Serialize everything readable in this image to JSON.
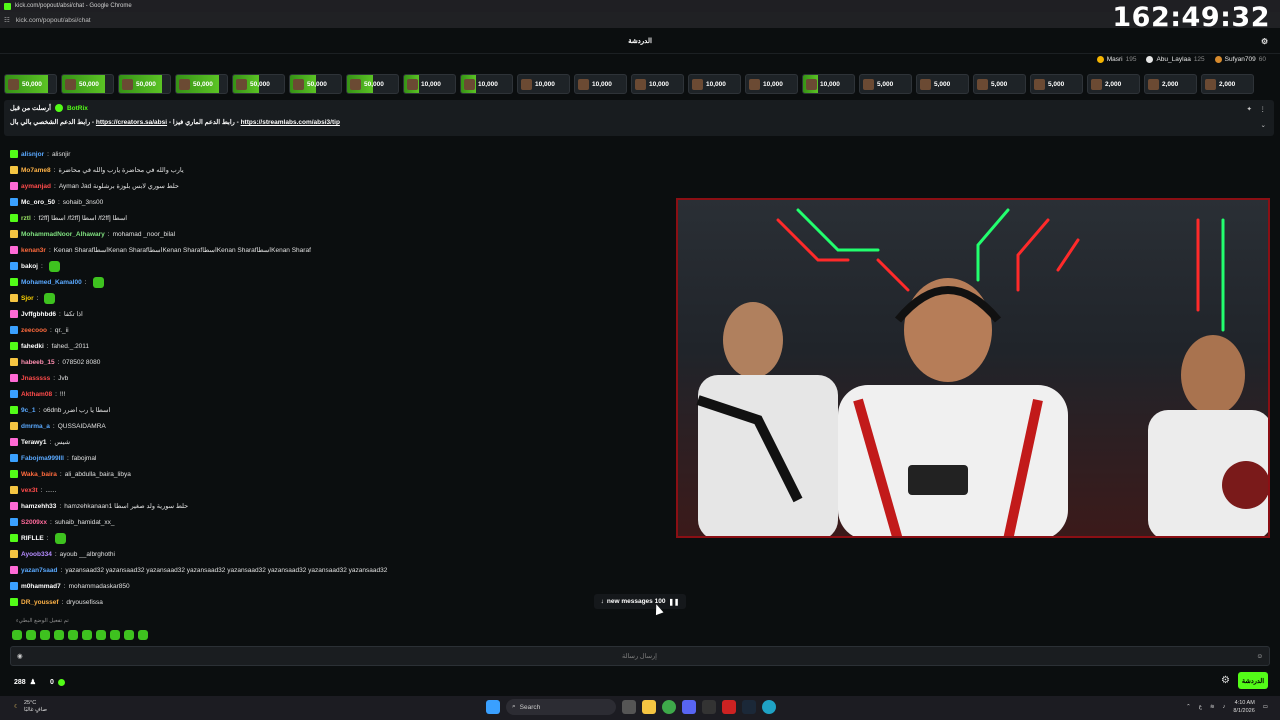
{
  "window": {
    "title": "kick.com/popout/absi/chat - Google Chrome"
  },
  "urlbar": {
    "url": "kick.com/popout/absi/chat"
  },
  "overlay": {
    "timer": "162:49:32"
  },
  "chat_header": {
    "title": "الدردشة"
  },
  "leaderboard": [
    {
      "name": "Masri",
      "count": "195",
      "color": "#f5b400"
    },
    {
      "name": "Abu_Laylaa",
      "count": "125",
      "color": "#e6e6e6"
    },
    {
      "name": "Sufyan709",
      "count": "60",
      "color": "#d68a2d"
    }
  ],
  "gifts": [
    {
      "amount": "50,000",
      "progress": 0.85
    },
    {
      "amount": "50,000",
      "progress": 0.85
    },
    {
      "amount": "50,000",
      "progress": 0.85
    },
    {
      "amount": "50,000",
      "progress": 0.85
    },
    {
      "amount": "50,000",
      "progress": 0.5
    },
    {
      "amount": "50,000",
      "progress": 0.5
    },
    {
      "amount": "50,000",
      "progress": 0.5
    },
    {
      "amount": "10,000",
      "progress": 0.3
    },
    {
      "amount": "10,000",
      "progress": 0.3
    },
    {
      "amount": "10,000",
      "progress": 0
    },
    {
      "amount": "10,000",
      "progress": 0
    },
    {
      "amount": "10,000",
      "progress": 0
    },
    {
      "amount": "10,000",
      "progress": 0
    },
    {
      "amount": "10,000",
      "progress": 0
    },
    {
      "amount": "10,000",
      "progress": 0.3
    },
    {
      "amount": "5,000",
      "progress": 0
    },
    {
      "amount": "5,000",
      "progress": 0
    },
    {
      "amount": "5,000",
      "progress": 0
    },
    {
      "amount": "5,000",
      "progress": 0
    },
    {
      "amount": "2,000",
      "progress": 0
    },
    {
      "amount": "2,000",
      "progress": 0
    },
    {
      "amount": "2,000",
      "progress": 0
    }
  ],
  "pinned": {
    "author": "BotRix",
    "prefix": "أرسلت من قبل",
    "text1": "رابط الدعم الشخصي بالي بال - ",
    "link1": "https://creators.sa/absi",
    "text2": " - رابط الدعم الماري فيزا - ",
    "link2": "https://streamlabs.com/absi3/tip"
  },
  "messages": [
    {
      "user": "alisnjor",
      "color": "#5aa9ff",
      "text": "alisnjir"
    },
    {
      "user": "Mo7ame8",
      "color": "#ffb347",
      "text": "يارب والله في محاضرة يارب والله في محاضرة"
    },
    {
      "user": "aymanjad",
      "color": "#ff4b4b",
      "text": "Ayman Jad حلط سوري لابس بلوزة برشلونة"
    },
    {
      "user": "Mc_oro_50",
      "color": "#ffffff",
      "text": "sohaib_3ns00"
    },
    {
      "user": "rztl",
      "color": "#9be564",
      "text": "f2ff] اسطا /f2ff] اسطا /f2ff] اسطا"
    },
    {
      "user": "MohammadNoor_Alhawary",
      "color": "#7fe07f",
      "text": "mohamad _noor_bilal"
    },
    {
      "user": "kenan3r",
      "color": "#ff6a3d",
      "text": "Kenan SharafاسطاKenan SharafاسطاKenan SharafاسطاKenan SharafاسطاKenan Sharaf"
    },
    {
      "user": "bakoj",
      "color": "#ffffff",
      "text": ""
    },
    {
      "user": "Mohamed_Kamal00",
      "color": "#5aa9ff",
      "text": ""
    },
    {
      "user": "Sjor",
      "color": "#ffd400",
      "text": ""
    },
    {
      "user": "Jvffgbhbd6",
      "color": "#ffffff",
      "text": "اذا تكفا"
    },
    {
      "user": "zeecooo",
      "color": "#ff6a3d",
      "text": "qr._ii"
    },
    {
      "user": "fahedki",
      "color": "#ffffff",
      "text": "fahed._.2011"
    },
    {
      "user": "habeeb_15",
      "color": "#ff8fb1",
      "text": "078502 8080"
    },
    {
      "user": "Jnasssss",
      "color": "#ff4b4b",
      "text": "Jvb"
    },
    {
      "user": "Aktham08",
      "color": "#ff4b4b",
      "text": "!!!"
    },
    {
      "user": "9c_1",
      "color": "#5aa9ff",
      "text": "o6dnb اسطا يا رب اضرر"
    },
    {
      "user": "dmrma_a",
      "color": "#5aa9ff",
      "text": "QUSSAIDAMRA"
    },
    {
      "user": "Terawy1",
      "color": "#ffffff",
      "text": "شيس"
    },
    {
      "user": "Fabojma999lll",
      "color": "#5aa9ff",
      "text": "fabojmal"
    },
    {
      "user": "Waka_baira",
      "color": "#ff6a3d",
      "text": "ali_abdulla_baira_libya"
    },
    {
      "user": "vex3t",
      "color": "#ff4b4b",
      "text": "......"
    },
    {
      "user": "hamzehh33",
      "color": "#ffffff",
      "text": "hamzehkanaan1 حلط سورية ولد صغير اسطا"
    },
    {
      "user": "S2009xx",
      "color": "#ff6a9b",
      "text": "suhaib_hamidat_xx_"
    },
    {
      "user": "RIFLLE",
      "color": "#ffffff",
      "text": ""
    },
    {
      "user": "Ayoob334",
      "color": "#b58cff",
      "text": "ayoub __albrghothi"
    },
    {
      "user": "yazan7saad",
      "color": "#5aa9ff",
      "text": "yazansaad32 yazansaad32 yazansaad32 yazansaad32 yazansaad32 yazansaad32 yazansaad32 yazansaad32"
    },
    {
      "user": "m0hammad7",
      "color": "#ffffff",
      "text": "mohammadaskar850"
    },
    {
      "user": "DR_youssef",
      "color": "#ffb347",
      "text": "dryousefissa"
    }
  ],
  "new_messages": {
    "label": "new messages 100"
  },
  "reply_hint": "تم تفعيل الوضع البطيء",
  "input": {
    "placeholder": "إرسال رسالة"
  },
  "footer": {
    "viewers": "288",
    "points": "0",
    "send_label": "الدردشة"
  },
  "taskbar": {
    "weather_temp": "25°C",
    "weather_desc": "صافٍ غالبًا",
    "search": "Search",
    "time": "4:10 AM",
    "date": "8/1/2026",
    "lang": "ع"
  }
}
